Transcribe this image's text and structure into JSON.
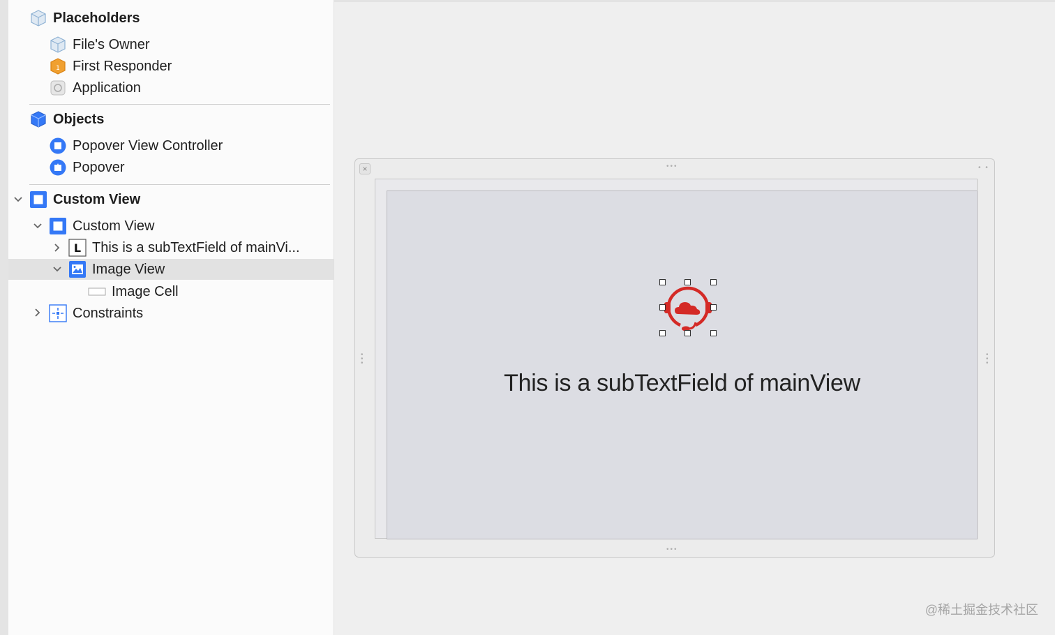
{
  "outline": {
    "placeholders": {
      "title": "Placeholders",
      "items": [
        "File's Owner",
        "First Responder",
        "Application"
      ]
    },
    "objects": {
      "title": "Objects",
      "items": [
        "Popover View Controller",
        "Popover"
      ]
    },
    "custom_view": {
      "title": "Custom View",
      "children": {
        "custom_view": "Custom View",
        "text_field": "This is a subTextField of mainVi...",
        "image_view": "Image View",
        "image_cell": "Image Cell",
        "constraints": "Constraints"
      }
    },
    "text_field_icon_letter": "L",
    "selected_item": "Image View"
  },
  "canvas": {
    "main_view_text": "This is a subTextField of mainView",
    "image_icon": "cloud-headset-icon",
    "close_symbol": "×"
  },
  "watermark": "@稀土掘金技术社区",
  "colors": {
    "accent_blue": "#3478f6",
    "icon_red": "#d42a26",
    "selection": "#e2e2e2"
  }
}
